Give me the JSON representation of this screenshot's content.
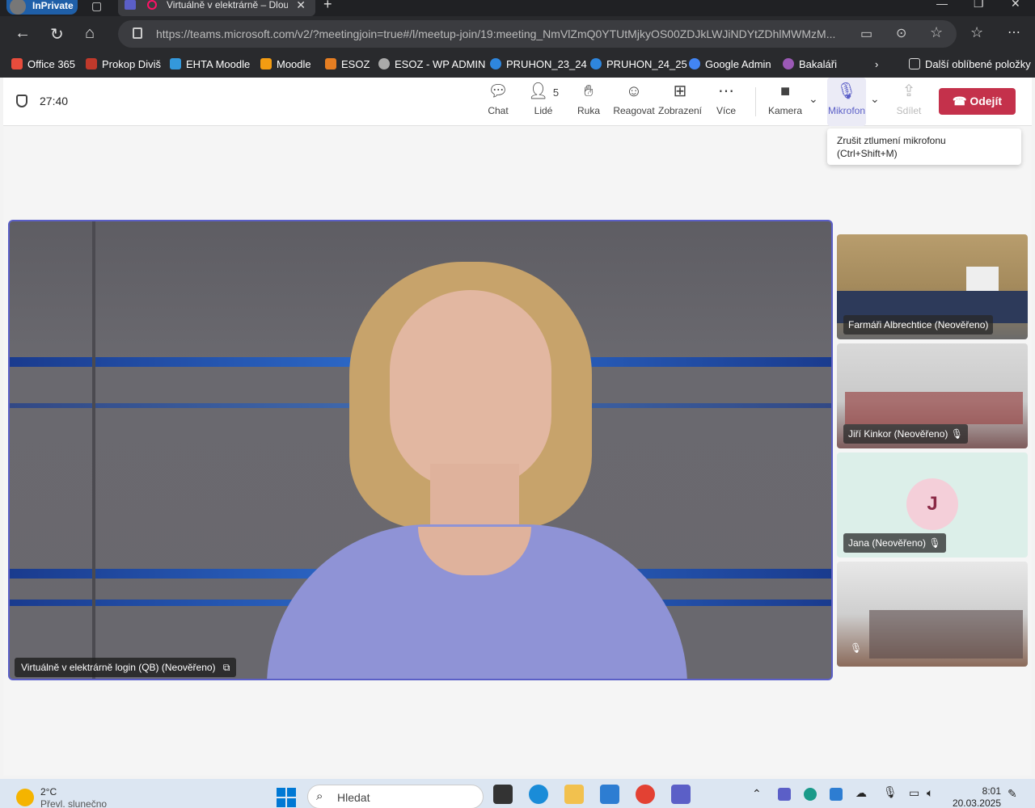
{
  "browser": {
    "inprivate_label": "InPrivate",
    "tab_title": "Virtuálně v elektrárně – Dloul",
    "url": "https://teams.microsoft.com/v2/?meetingjoin=true#/l/meetup-join/19:meeting_NmVlZmQ0YTUtMjkyOS00ZDJkLWJiNDYtZDhlMWMzM...",
    "favorites": [
      {
        "label": "Office 365",
        "color": "#e74c3c"
      },
      {
        "label": "Prokop Diviš",
        "color": "#c0392b"
      },
      {
        "label": "EHTA Moodle",
        "color": "#3498db"
      },
      {
        "label": "Moodle",
        "color": "#f39c12"
      },
      {
        "label": "ESOZ",
        "color": "#e67e22"
      },
      {
        "label": "ESOZ - WP ADMIN",
        "color": "#aaaaaa"
      },
      {
        "label": "PRUHON_23_24",
        "color": "#2e86de"
      },
      {
        "label": "PRUHON_24_25",
        "color": "#2e86de"
      },
      {
        "label": "Google Admin",
        "color": "#4285f4"
      },
      {
        "label": "Bakaláři",
        "color": "#9b59b6"
      }
    ],
    "other_favorites": "Další oblíbené položky"
  },
  "meeting": {
    "timer": "27:40",
    "people_count": "5",
    "controls": {
      "chat": "Chat",
      "people": "Lidé",
      "hand": "Ruka",
      "react": "Reagovat",
      "view": "Zobrazení",
      "more": "Více",
      "camera": "Kamera",
      "mic": "Mikrofon",
      "share": "Sdílet",
      "leave": "Odejít"
    },
    "tooltip": {
      "line1": "Zrušit ztlumení mikrofonu",
      "line2": "(Ctrl+Shift+M)"
    },
    "main_speaker": "Virtuálně v elektrárně login (QB) (Neověřeno)",
    "participants": [
      {
        "name": "Farmáři Albrechtice (Neověřeno)",
        "muted": false
      },
      {
        "name": "Jiří Kinkor (Neověřeno)",
        "muted": true
      },
      {
        "name": "Jana (Neověřeno)",
        "muted": true,
        "initial": "J"
      },
      {
        "name": "",
        "muted": true
      }
    ]
  },
  "taskbar": {
    "weather_temp": "2°C",
    "weather_desc": "Převl. slunečno",
    "search_placeholder": "Hledat",
    "time": "8:01",
    "date": "20.03.2025"
  }
}
